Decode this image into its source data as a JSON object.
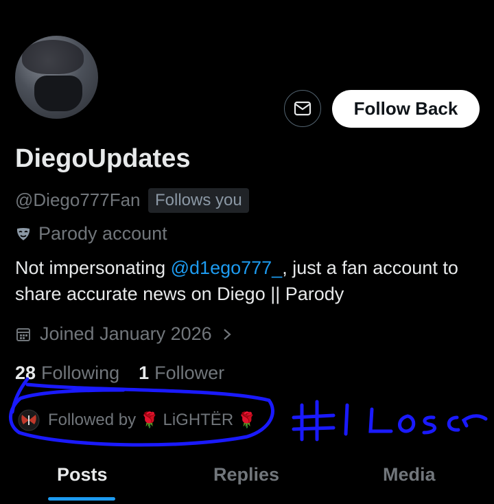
{
  "profile": {
    "display_name": "DiegoUpdates",
    "handle": "@Diego777Fan",
    "follows_you_badge": "Follows you",
    "label": "Parody account",
    "label_icon": "mask-icon",
    "bio_prefix": "Not impersonating ",
    "bio_mention": "@d1ego777_",
    "bio_suffix": ", just a fan account to share accurate news on Diego || Parody",
    "joined": "Joined January 2026"
  },
  "actions": {
    "message_icon": "envelope-icon",
    "follow_back_label": "Follow Back"
  },
  "stats": {
    "following_count": "28",
    "following_label": "Following",
    "followers_count": "1",
    "followers_label": "Follower"
  },
  "followed_by": {
    "text": "Followed by",
    "name": "LiGHTËR"
  },
  "annotation": {
    "text": "#1 Loser",
    "color": "#1a1aff"
  },
  "tabs": [
    {
      "label": "Posts",
      "active": true
    },
    {
      "label": "Replies",
      "active": false
    },
    {
      "label": "Media",
      "active": false
    }
  ],
  "colors": {
    "accent": "#1d9bf0",
    "background": "#000000",
    "secondary_text": "#71767b"
  }
}
